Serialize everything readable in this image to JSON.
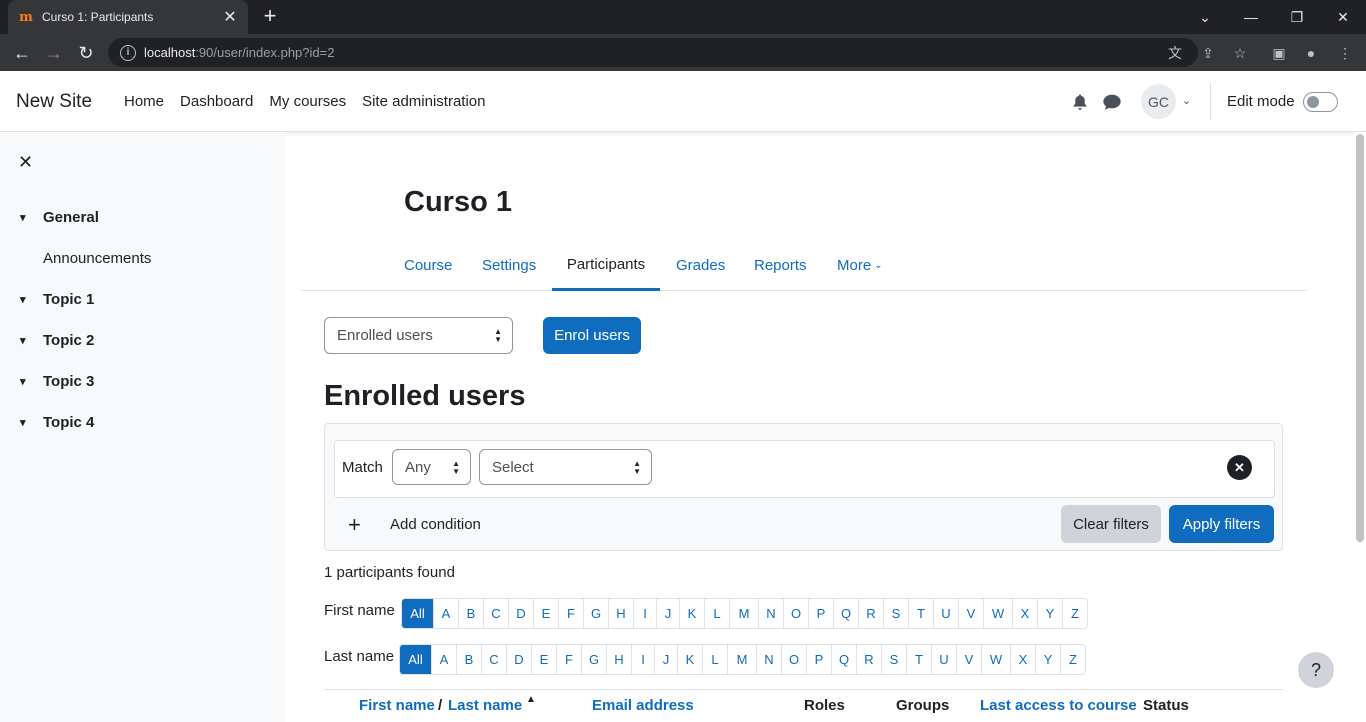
{
  "browser": {
    "tab_title": "Curso 1: Participants",
    "url_host": "localhost",
    "url_path": ":90/user/index.php?id=2"
  },
  "navbar": {
    "brand": "New Site",
    "items": [
      "Home",
      "Dashboard",
      "My courses",
      "Site administration"
    ],
    "avatar_initials": "GC",
    "edit_mode_label": "Edit mode"
  },
  "course_index": {
    "sections": [
      {
        "title": "General",
        "activities": [
          "Announcements"
        ]
      },
      {
        "title": "Topic 1"
      },
      {
        "title": "Topic 2"
      },
      {
        "title": "Topic 3"
      },
      {
        "title": "Topic 4"
      }
    ]
  },
  "page": {
    "course_title": "Curso 1",
    "secondary_nav": [
      "Course",
      "Settings",
      "Participants",
      "Grades",
      "Reports",
      "More"
    ],
    "active_tab": "Participants",
    "view_select_value": "Enrolled users",
    "enrol_button": "Enrol users",
    "heading": "Enrolled users"
  },
  "filters": {
    "match_label": "Match",
    "match_value": "Any",
    "condition_value": "Select",
    "add_condition": "Add condition",
    "clear_button": "Clear filters",
    "apply_button": "Apply filters"
  },
  "results": {
    "found_text": "1 participants found",
    "first_name_label": "First name",
    "last_name_label": "Last name",
    "initials": [
      "All",
      "A",
      "B",
      "C",
      "D",
      "E",
      "F",
      "G",
      "H",
      "I",
      "J",
      "K",
      "L",
      "M",
      "N",
      "O",
      "P",
      "Q",
      "R",
      "S",
      "T",
      "U",
      "V",
      "W",
      "X",
      "Y",
      "Z"
    ]
  },
  "table": {
    "headers": {
      "first_name": "First name",
      "separator": "/",
      "last_name": "Last name",
      "email": "Email address",
      "roles": "Roles",
      "groups": "Groups",
      "last_access": "Last access to course",
      "status": "Status"
    }
  },
  "help": "?",
  "colors": {
    "primary": "#0f6cbf",
    "text": "#1d2125",
    "drawer_bg": "#f8f9fa"
  }
}
